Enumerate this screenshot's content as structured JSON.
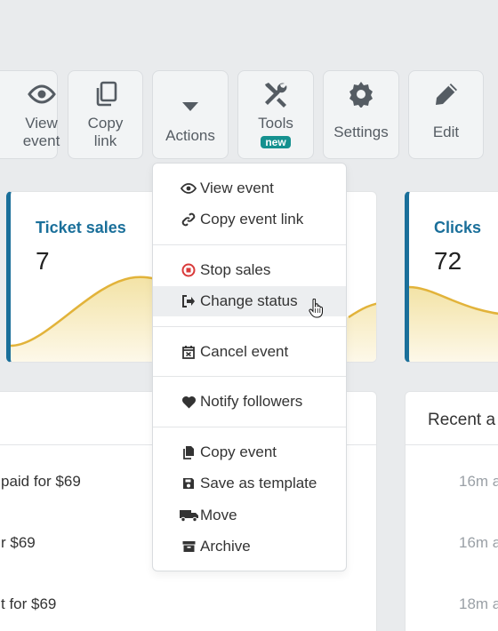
{
  "toolbar": {
    "view_event": {
      "line1": "View",
      "line2": "event",
      "icon": "eye-icon"
    },
    "copy_link": {
      "line1": "Copy",
      "line2": "link",
      "icon": "copy-icon"
    },
    "actions": {
      "label": "Actions",
      "icon": "caret-down-icon"
    },
    "tools": {
      "label": "Tools",
      "badge": "new",
      "icon": "tools-icon"
    },
    "settings": {
      "label": "Settings",
      "icon": "gear-icon"
    },
    "edit": {
      "label": "Edit",
      "icon": "pencil-icon"
    }
  },
  "stats": [
    {
      "title": "Ticket sales",
      "value": "7"
    },
    {
      "title": "Clicks",
      "value": "72"
    }
  ],
  "accent_color": "#1a6f9a",
  "chart_color": "#e2b33a",
  "recent": {
    "title": "Recent a",
    "times": [
      "16m a",
      "16m a",
      "18m a"
    ]
  },
  "orders": [
    "paid for $69",
    "r $69",
    "t for $69"
  ],
  "menu": {
    "items": [
      {
        "label": "View event",
        "icon": "eye-icon"
      },
      {
        "label": "Copy event link",
        "icon": "link-icon"
      },
      {
        "label": "Stop sales",
        "icon": "stop-circle-icon"
      },
      {
        "label": "Change status",
        "icon": "sign-out-icon"
      },
      {
        "label": "Cancel event",
        "icon": "calendar-x-icon"
      },
      {
        "label": "Notify followers",
        "icon": "heart-icon"
      },
      {
        "label": "Copy event",
        "icon": "file-copy-icon"
      },
      {
        "label": "Save as template",
        "icon": "save-icon"
      },
      {
        "label": "Move",
        "icon": "truck-icon"
      },
      {
        "label": "Archive",
        "icon": "archive-icon"
      }
    ]
  }
}
